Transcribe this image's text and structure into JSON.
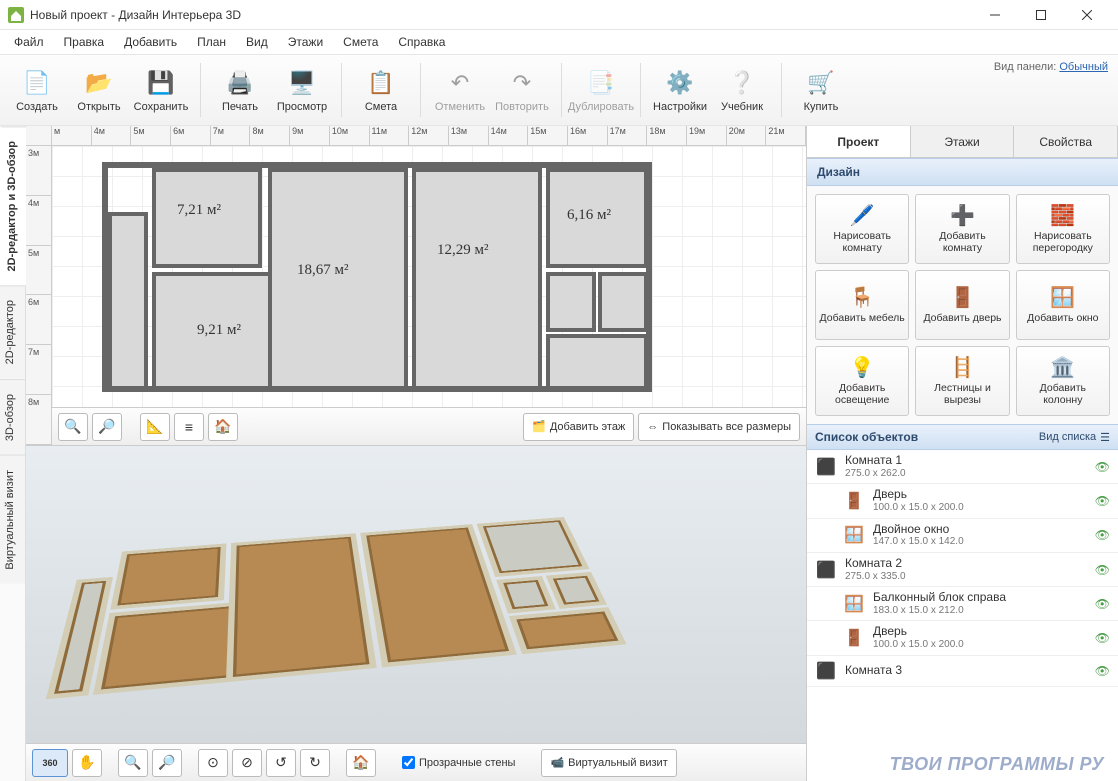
{
  "window": {
    "title": "Новый проект - Дизайн Интерьера 3D"
  },
  "menu": [
    "Файл",
    "Правка",
    "Добавить",
    "План",
    "Вид",
    "Этажи",
    "Смета",
    "Справка"
  ],
  "panel_mode": {
    "label": "Вид панели:",
    "value": "Обычный"
  },
  "toolbar": [
    {
      "id": "create",
      "label": "Создать",
      "icon": "📄"
    },
    {
      "id": "open",
      "label": "Открыть",
      "icon": "📂"
    },
    {
      "id": "save",
      "label": "Сохранить",
      "icon": "💾"
    },
    {
      "sep": true
    },
    {
      "id": "print",
      "label": "Печать",
      "icon": "🖨️"
    },
    {
      "id": "preview",
      "label": "Просмотр",
      "icon": "🖥️"
    },
    {
      "sep": true
    },
    {
      "id": "estimate",
      "label": "Смета",
      "icon": "📋"
    },
    {
      "sep": true
    },
    {
      "id": "undo",
      "label": "Отменить",
      "icon": "↶",
      "disabled": true
    },
    {
      "id": "redo",
      "label": "Повторить",
      "icon": "↷",
      "disabled": true
    },
    {
      "sep": true
    },
    {
      "id": "duplicate",
      "label": "Дублировать",
      "icon": "📑",
      "disabled": true
    },
    {
      "sep": true
    },
    {
      "id": "settings",
      "label": "Настройки",
      "icon": "⚙️"
    },
    {
      "id": "tutorial",
      "label": "Учебник",
      "icon": "❔"
    },
    {
      "sep": true
    },
    {
      "id": "buy",
      "label": "Купить",
      "icon": "🛒"
    }
  ],
  "vtabs": [
    {
      "id": "both",
      "label": "2D-редактор и 3D-обзор",
      "active": true
    },
    {
      "id": "2d",
      "label": "2D-редактор"
    },
    {
      "id": "3d",
      "label": "3D-обзор"
    },
    {
      "id": "virtual",
      "label": "Виртуальный визит"
    }
  ],
  "ruler_h": [
    "м",
    "4м",
    "5м",
    "6м",
    "7м",
    "8м",
    "9м",
    "10м",
    "11м",
    "12м",
    "13м",
    "14м",
    "15м",
    "16м",
    "17м",
    "18м",
    "19м",
    "20м",
    "21м"
  ],
  "ruler_v": [
    "3м",
    "4м",
    "5м",
    "6м",
    "7м",
    "8м"
  ],
  "rooms": {
    "r1": "7,21 м²",
    "r2": "18,67 м²",
    "r3": "12,29 м²",
    "r4": "6,16 м²",
    "r5": "9,21 м²"
  },
  "plan_toolbar": {
    "add_floor": "Добавить этаж",
    "show_dims": "Показывать все размеры"
  },
  "view3d_toolbar": {
    "transparent_walls": "Прозрачные стены",
    "virtual_visit": "Виртуальный визит"
  },
  "right": {
    "tabs": [
      "Проект",
      "Этажи",
      "Свойства"
    ],
    "design_hdr": "Дизайн",
    "tools": [
      {
        "label": "Нарисовать комнату",
        "icon": "🖊️"
      },
      {
        "label": "Добавить комнату",
        "icon": "➕"
      },
      {
        "label": "Нарисовать перегородку",
        "icon": "🧱"
      },
      {
        "label": "Добавить мебель",
        "icon": "🪑"
      },
      {
        "label": "Добавить дверь",
        "icon": "🚪"
      },
      {
        "label": "Добавить окно",
        "icon": "🪟"
      },
      {
        "label": "Добавить освещение",
        "icon": "💡"
      },
      {
        "label": "Лестницы и вырезы",
        "icon": "🪜"
      },
      {
        "label": "Добавить колонну",
        "icon": "🏛️"
      }
    ],
    "objlist_hdr": "Список объектов",
    "objlist_viewlabel": "Вид списка",
    "objects": [
      {
        "name": "Комната 1",
        "dims": "275.0 x 262.0",
        "icon": "⬛",
        "child": false
      },
      {
        "name": "Дверь",
        "dims": "100.0 x 15.0 x 200.0",
        "icon": "🚪",
        "child": true
      },
      {
        "name": "Двойное окно",
        "dims": "147.0 x 15.0 x 142.0",
        "icon": "🪟",
        "child": true
      },
      {
        "name": "Комната 2",
        "dims": "275.0 x 335.0",
        "icon": "⬛",
        "child": false
      },
      {
        "name": "Балконный блок справа",
        "dims": "183.0 x 15.0 x 212.0",
        "icon": "🪟",
        "child": true
      },
      {
        "name": "Дверь",
        "dims": "100.0 x 15.0 x 200.0",
        "icon": "🚪",
        "child": true
      },
      {
        "name": "Комната 3",
        "dims": "",
        "icon": "⬛",
        "child": false
      }
    ]
  },
  "watermark": "ТВОИ ПРОГРАММЫ РУ"
}
